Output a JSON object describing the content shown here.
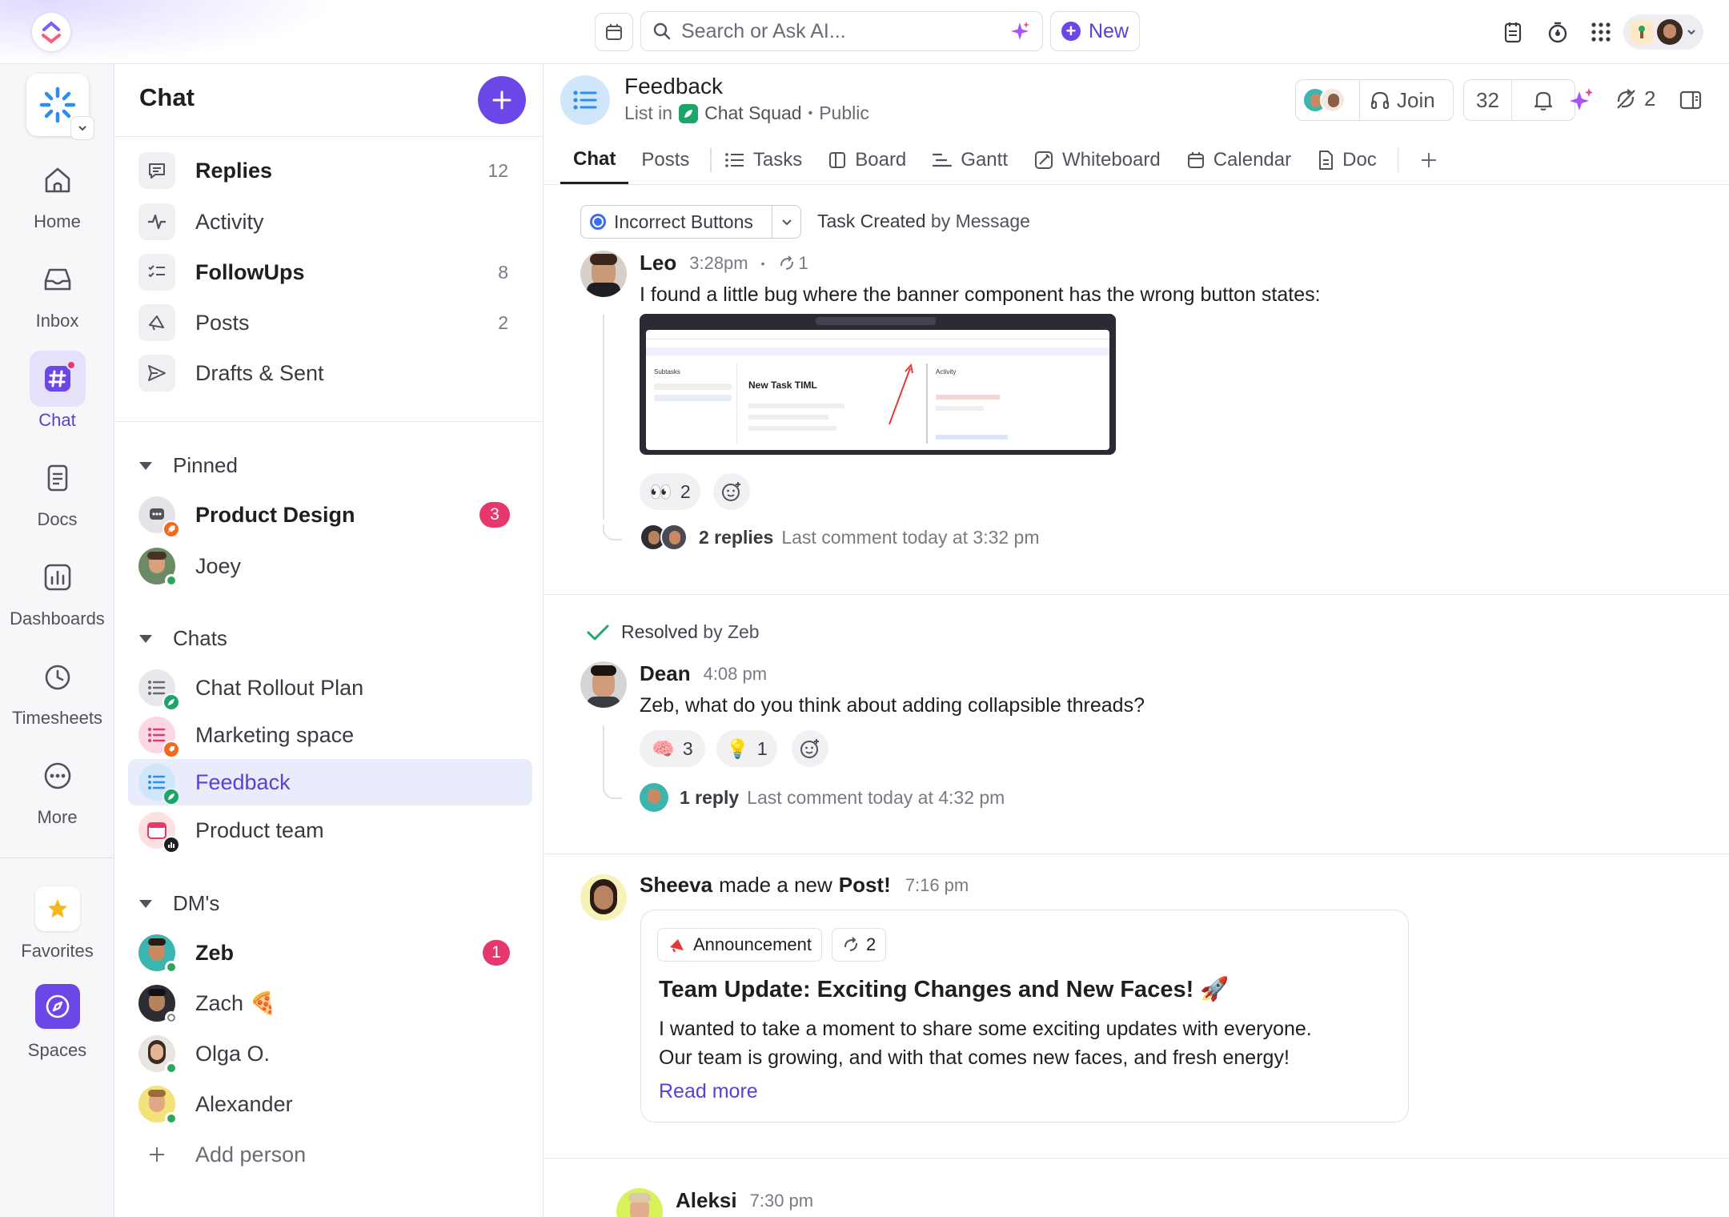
{
  "topbar": {
    "search_placeholder": "Search or Ask AI...",
    "new_label": "New"
  },
  "rail": {
    "items": [
      {
        "label": "Home"
      },
      {
        "label": "Inbox"
      },
      {
        "label": "Chat"
      },
      {
        "label": "Docs"
      },
      {
        "label": "Dashboards"
      },
      {
        "label": "Timesheets"
      },
      {
        "label": "More"
      },
      {
        "label": "Favorites"
      },
      {
        "label": "Spaces"
      }
    ]
  },
  "sidebar": {
    "title": "Chat",
    "nav": [
      {
        "label": "Replies",
        "count": "12"
      },
      {
        "label": "Activity",
        "count": ""
      },
      {
        "label": "FollowUps",
        "count": "8"
      },
      {
        "label": "Posts",
        "count": "2"
      },
      {
        "label": "Drafts & Sent",
        "count": ""
      }
    ],
    "pinned_header": "Pinned",
    "pinned": [
      {
        "label": "Product Design",
        "badge": "3"
      },
      {
        "label": "Joey"
      }
    ],
    "chats_header": "Chats",
    "chats": [
      {
        "label": "Chat Rollout Plan"
      },
      {
        "label": "Marketing space"
      },
      {
        "label": "Feedback"
      },
      {
        "label": "Product team"
      }
    ],
    "dms_header": "DM's",
    "dms": [
      {
        "label": "Zeb",
        "badge": "1"
      },
      {
        "label": "Zach 🍕"
      },
      {
        "label": "Olga O."
      },
      {
        "label": "Alexander"
      }
    ],
    "add_person": "Add person"
  },
  "header": {
    "title": "Feedback",
    "sub_prefix": "List in",
    "space": "Chat Squad",
    "separator": "•",
    "visibility": "Public",
    "join": "Join",
    "member_count": "32",
    "ai_count": "2",
    "tabs": [
      {
        "label": "Chat"
      },
      {
        "label": "Posts"
      },
      {
        "label": "Tasks"
      },
      {
        "label": "Board"
      },
      {
        "label": "Gantt"
      },
      {
        "label": "Whiteboard"
      },
      {
        "label": "Calendar"
      },
      {
        "label": "Doc"
      }
    ]
  },
  "messages": {
    "task_chip": "Incorrect Buttons",
    "task_note_bold": "Task Created",
    "task_note_rest": "by Message",
    "leo": {
      "name": "Leo",
      "time": "3:28pm",
      "dot": "•",
      "assign_count": "1",
      "text": "I found a little bug where the banner component has the wrong button states:",
      "screenshot_title": "New Task TIML",
      "screenshot_panel": "Activity",
      "screenshot_subtasks": "Subtasks",
      "reaction_emoji": "👀",
      "reaction_count": "2",
      "replies": "2 replies",
      "last_comment": "Last comment today at 3:32 pm"
    },
    "resolved_bold": "Resolved",
    "resolved_rest": "by Zeb",
    "dean": {
      "name": "Dean",
      "time": "4:08 pm",
      "text": "Zeb, what do you think about adding collapsible threads?",
      "reaction1_emoji": "🧠",
      "reaction1_count": "3",
      "reaction2_emoji": "💡",
      "reaction2_count": "1",
      "replies": "1 reply",
      "last_comment": "Last comment today at 4:32 pm"
    },
    "sheeva": {
      "name": "Sheeva",
      "action": "made a new",
      "post_word": "Post!",
      "time": "7:16 pm",
      "chip": "Announcement",
      "chip_count": "2",
      "post_title": "Team Update: Exciting Changes and New Faces! 🚀",
      "post_line1": "I wanted to take a moment to share some exciting updates with everyone.",
      "post_line2": "Our team is growing, and with that comes new faces, and fresh energy!",
      "read_more": "Read more"
    },
    "aleksi": {
      "name": "Aleksi",
      "time": "7:30 pm"
    }
  },
  "colors": {
    "accent": "#6b47e8",
    "badge": "#e5396d",
    "online": "#2fa55a"
  }
}
